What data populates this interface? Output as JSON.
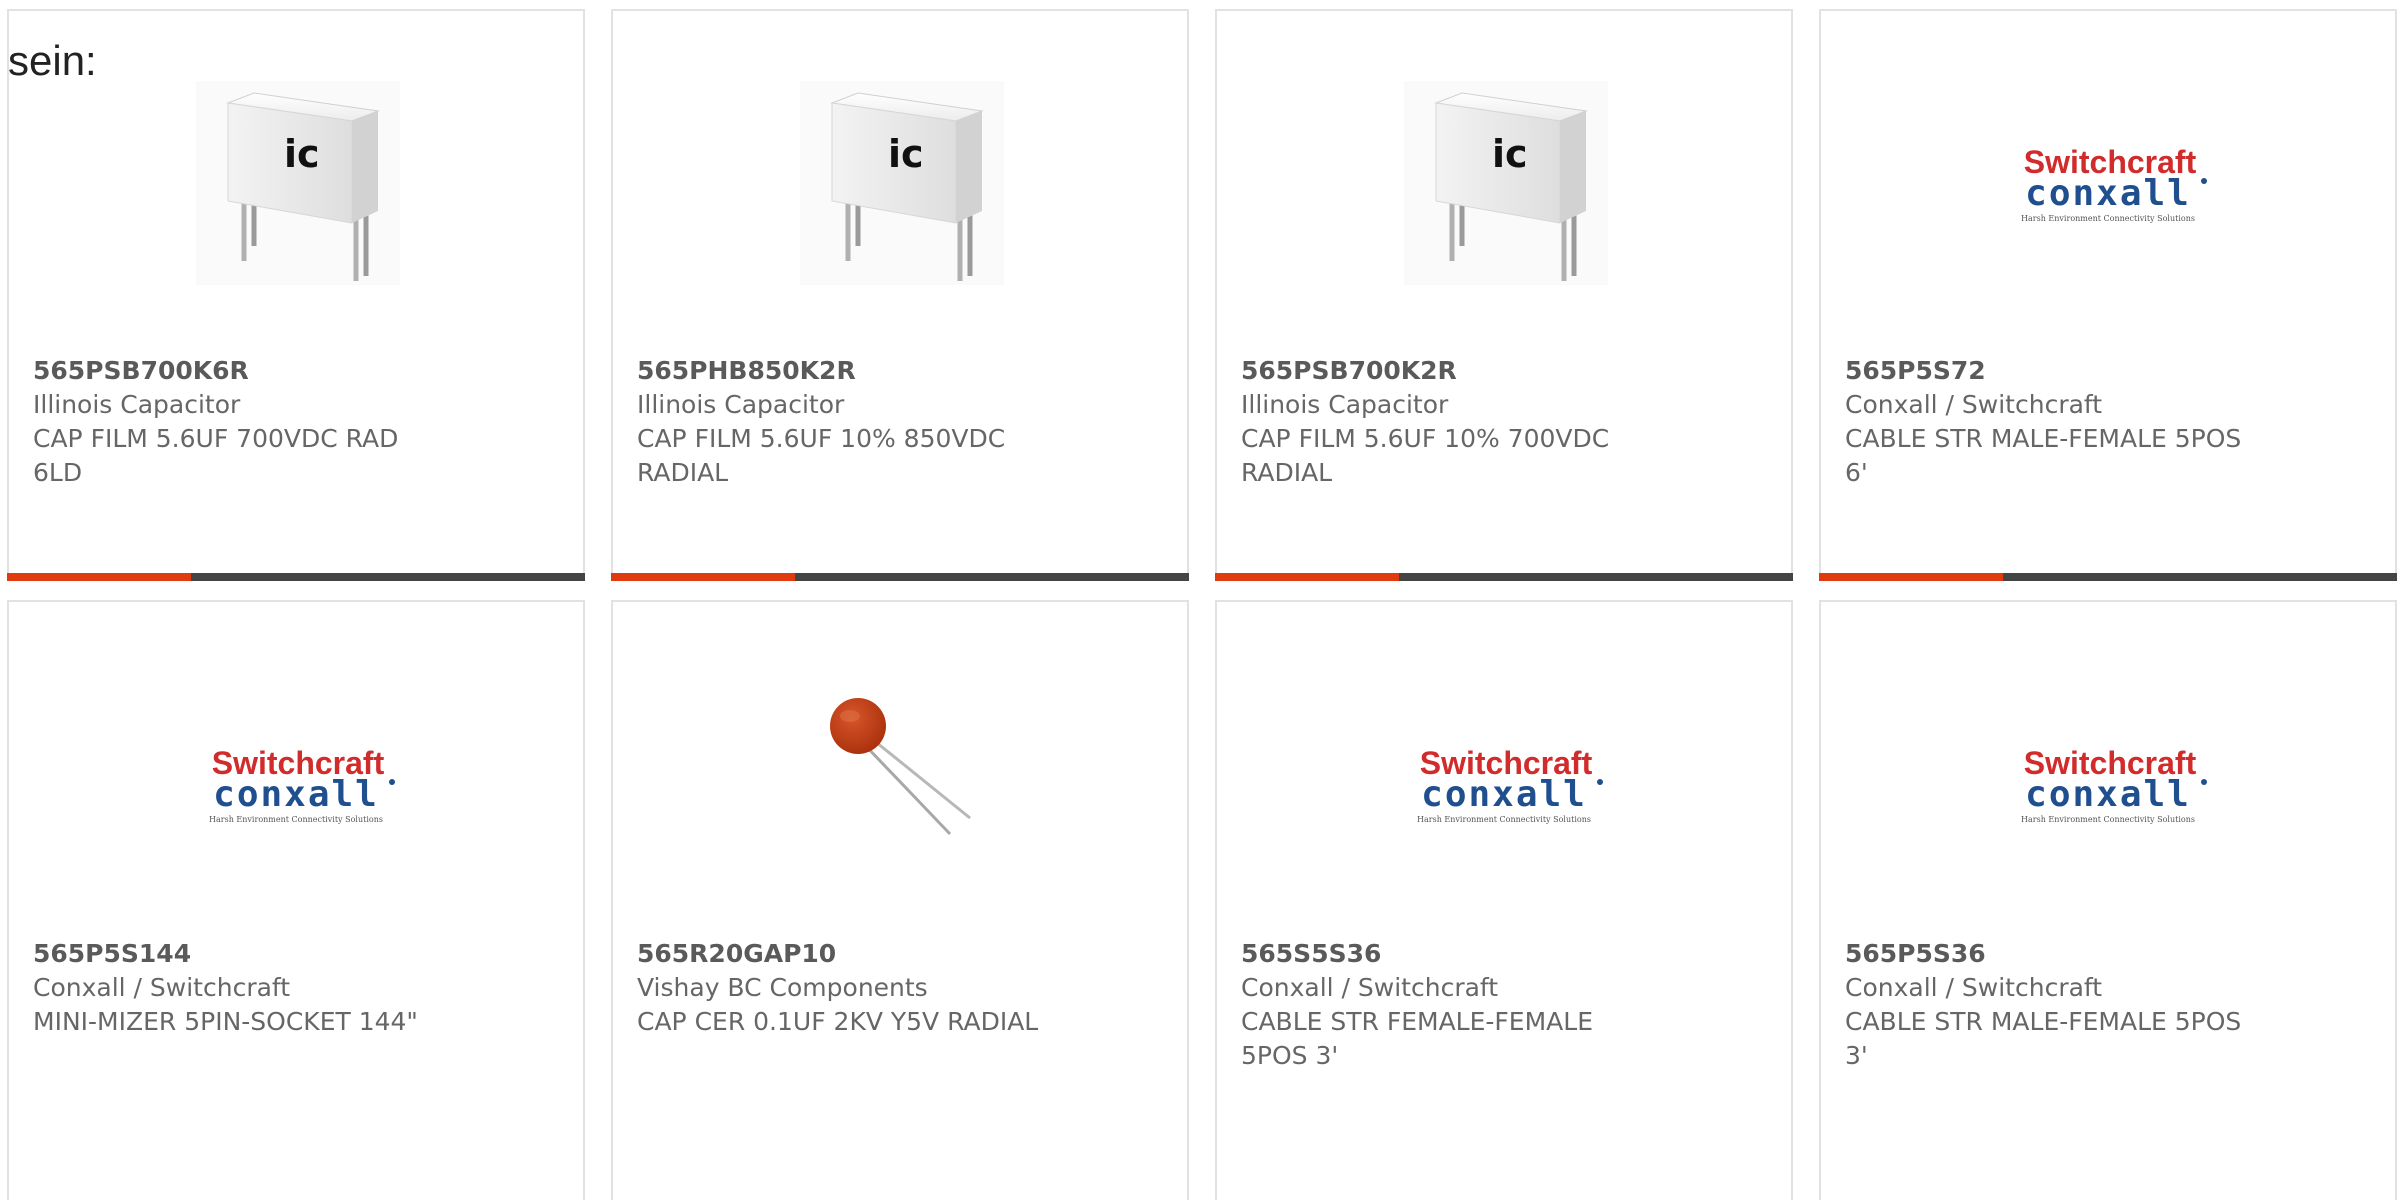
{
  "intro_text": "sein:",
  "colors": {
    "accent": "#e03a0f",
    "bar": "#444444",
    "text": "#666666",
    "border": "#e2e2e2"
  },
  "products": [
    {
      "part_number": "565PSB700K6R",
      "manufacturer": "Illinois Capacitor",
      "description": "CAP FILM 5.6UF 700VDC RAD 6LD",
      "image": "film-capacitor-image"
    },
    {
      "part_number": "565PHB850K2R",
      "manufacturer": "Illinois Capacitor",
      "description": "CAP FILM 5.6UF 10% 850VDC RADIAL",
      "image": "film-capacitor-image"
    },
    {
      "part_number": "565PSB700K2R",
      "manufacturer": "Illinois Capacitor",
      "description": "CAP FILM 5.6UF 10% 700VDC RADIAL",
      "image": "film-capacitor-image"
    },
    {
      "part_number": "565P5S72",
      "manufacturer": "Conxall / Switchcraft",
      "description": "CABLE STR MALE-FEMALE 5POS 6'",
      "image": "switchcraft-conxall-logo"
    },
    {
      "part_number": "565P5S144",
      "manufacturer": "Conxall / Switchcraft",
      "description": "MINI-MIZER 5PIN-SOCKET 144\"",
      "image": "switchcraft-conxall-logo"
    },
    {
      "part_number": "565R20GAP10",
      "manufacturer": "Vishay BC Components",
      "description": "CAP CER 0.1UF 2KV Y5V RADIAL",
      "image": "ceramic-disc-capacitor-image"
    },
    {
      "part_number": "565S5S36",
      "manufacturer": "Conxall / Switchcraft",
      "description": "CABLE STR FEMALE-FEMALE 5POS 3'",
      "image": "switchcraft-conxall-logo"
    },
    {
      "part_number": "565P5S36",
      "manufacturer": "Conxall / Switchcraft",
      "description": "CABLE STR MALE-FEMALE 5POS 3'",
      "image": "switchcraft-conxall-logo"
    }
  ],
  "logo": {
    "brand_top": "Switchcraft",
    "brand_bottom": "conxall",
    "tagline": "Harsh Environment Connectivity Solutions"
  },
  "capacitor_mark": "ic"
}
